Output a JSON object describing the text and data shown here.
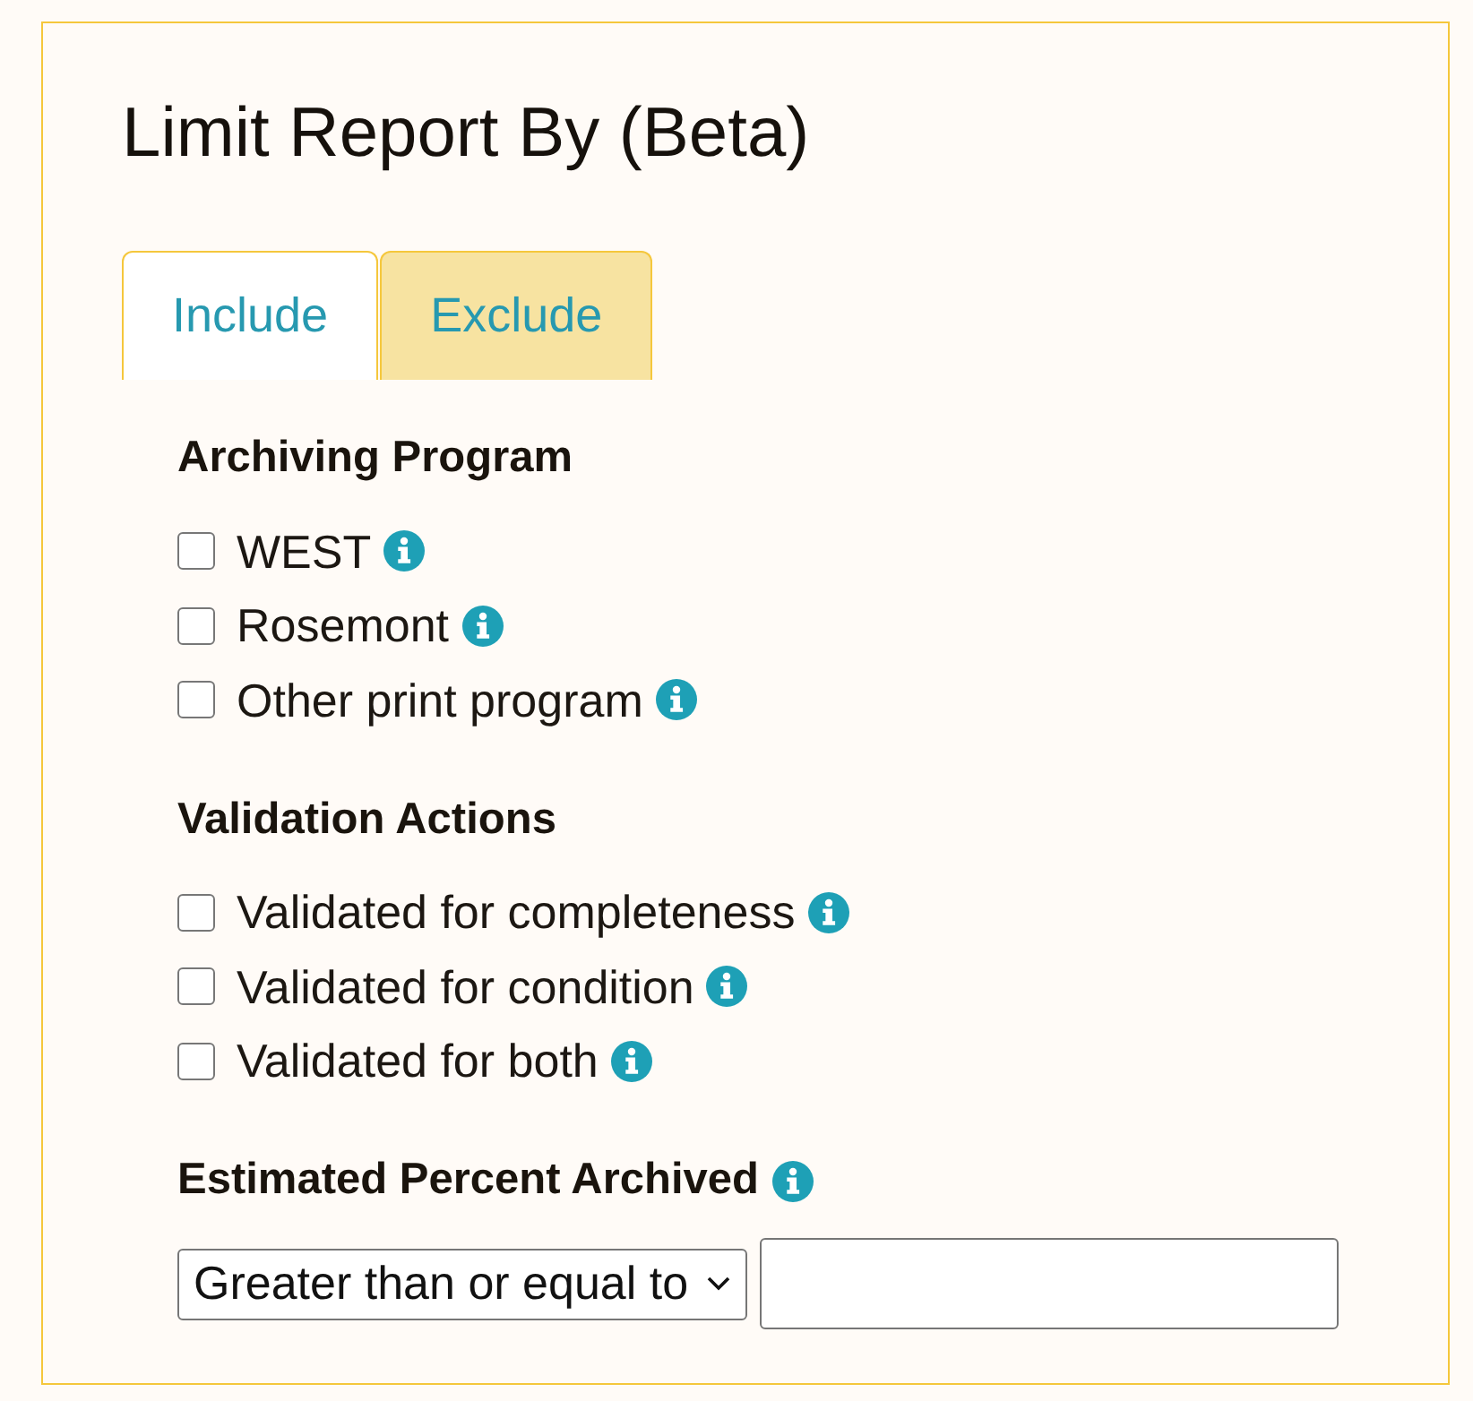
{
  "panel": {
    "title": "Limit Report By (Beta)"
  },
  "tabs": [
    {
      "label": "Include",
      "selected": true
    },
    {
      "label": "Exclude",
      "selected": false
    }
  ],
  "sections": [
    {
      "kind": "checkboxes",
      "heading": "Archiving Program",
      "info": false,
      "options": [
        {
          "label": "WEST",
          "checked": false,
          "info": true
        },
        {
          "label": "Rosemont",
          "checked": false,
          "info": true
        },
        {
          "label": "Other print program",
          "checked": false,
          "info": true
        }
      ]
    },
    {
      "kind": "checkboxes",
      "heading": "Validation Actions",
      "info": false,
      "options": [
        {
          "label": "Validated for completeness",
          "checked": false,
          "info": true
        },
        {
          "label": "Validated for condition",
          "checked": false,
          "info": true
        },
        {
          "label": "Validated for both",
          "checked": false,
          "info": true
        }
      ]
    },
    {
      "kind": "range",
      "heading": "Estimated Percent Archived",
      "info": true,
      "operator": "Greater than or equal to"
    }
  ]
}
